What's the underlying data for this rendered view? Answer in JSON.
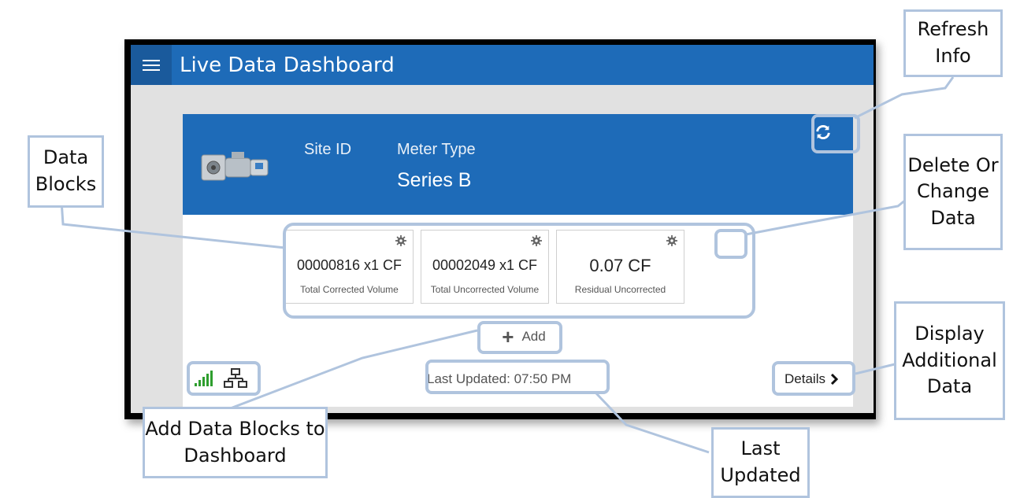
{
  "app": {
    "title": "Live Data Dashboard"
  },
  "site": {
    "site_id_label": "Site ID",
    "meter_type_label": "Meter Type",
    "meter_type_value": "Series B"
  },
  "data_blocks": [
    {
      "value": "00000816 x1 CF",
      "label": "Total Corrected Volume"
    },
    {
      "value": "00002049 x1 CF",
      "label": "Total Uncorrected Volume"
    },
    {
      "value": "0.07 CF",
      "label": "Residual Uncorrected"
    }
  ],
  "toolbar": {
    "add_label": "Add",
    "last_updated": "Last Updated: 07:50 PM",
    "details_label": "Details"
  },
  "annotations": {
    "refresh_info": "Refresh Info",
    "data_blocks": "Data Blocks",
    "delete_or_change": "Delete Or Change Data",
    "display_additional": "Display Additional Data",
    "add_data_blocks": "Add Data Blocks to Dashboard",
    "last_updated": "Last Updated"
  },
  "icons": {
    "menu": "hamburger-icon",
    "refresh": "refresh-icon",
    "settings": "gear-icon",
    "signal": "signal-strength-icon",
    "network": "network-icon",
    "add": "plus-icon",
    "details": "chevron-right-icon"
  },
  "colors": {
    "app_bar": "#1e6bb8",
    "annotation_border": "#b0c4de",
    "signal_green": "#2e9e2e"
  }
}
